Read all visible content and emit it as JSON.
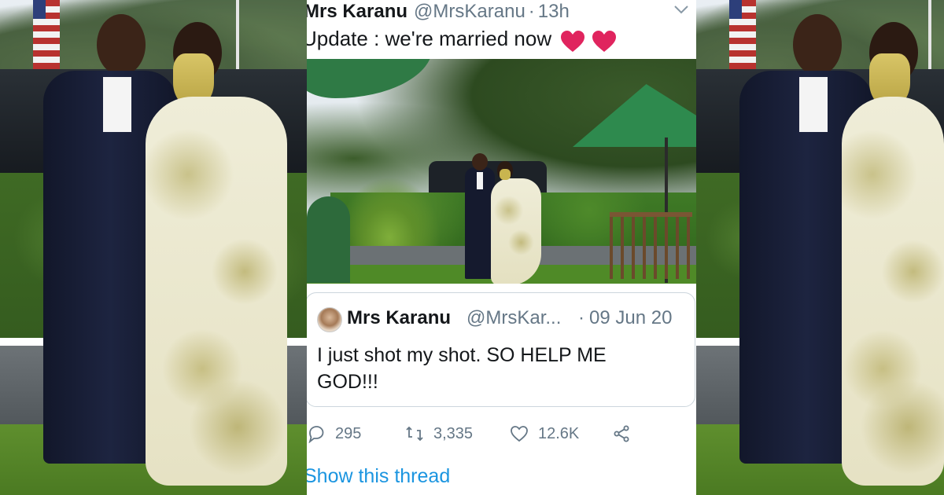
{
  "tweet": {
    "author_name": "Mrs Karanu",
    "author_handle": "@MrsKaranu",
    "separator": "·",
    "time": "13h",
    "text": "Update : we're married now",
    "emoji": "red-heart-icon",
    "show_thread": "Show this thread"
  },
  "quoted_tweet": {
    "author_name": "Mrs Karanu",
    "author_handle": "@MrsKar...",
    "separator": "·",
    "date": "09 Jun 20",
    "text": "I just shot my shot. SO HELP ME GOD!!!"
  },
  "actions": {
    "reply_count": "295",
    "retweet_count": "3,335",
    "like_count": "12.6K"
  },
  "colors": {
    "text_primary": "#14171a",
    "text_secondary": "#657786",
    "link": "#1b95e0",
    "heart": "#e0245e",
    "border": "#ccd6dd"
  }
}
